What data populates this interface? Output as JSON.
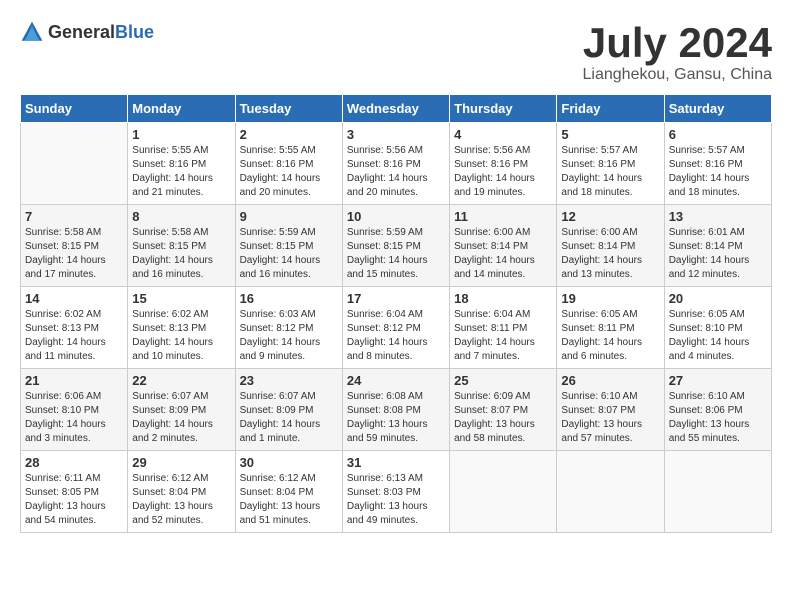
{
  "header": {
    "logo_general": "General",
    "logo_blue": "Blue",
    "month_year": "July 2024",
    "location": "Lianghekou, Gansu, China"
  },
  "days_of_week": [
    "Sunday",
    "Monday",
    "Tuesday",
    "Wednesday",
    "Thursday",
    "Friday",
    "Saturday"
  ],
  "weeks": [
    [
      {
        "day": "",
        "info": ""
      },
      {
        "day": "1",
        "info": "Sunrise: 5:55 AM\nSunset: 8:16 PM\nDaylight: 14 hours\nand 21 minutes."
      },
      {
        "day": "2",
        "info": "Sunrise: 5:55 AM\nSunset: 8:16 PM\nDaylight: 14 hours\nand 20 minutes."
      },
      {
        "day": "3",
        "info": "Sunrise: 5:56 AM\nSunset: 8:16 PM\nDaylight: 14 hours\nand 20 minutes."
      },
      {
        "day": "4",
        "info": "Sunrise: 5:56 AM\nSunset: 8:16 PM\nDaylight: 14 hours\nand 19 minutes."
      },
      {
        "day": "5",
        "info": "Sunrise: 5:57 AM\nSunset: 8:16 PM\nDaylight: 14 hours\nand 18 minutes."
      },
      {
        "day": "6",
        "info": "Sunrise: 5:57 AM\nSunset: 8:16 PM\nDaylight: 14 hours\nand 18 minutes."
      }
    ],
    [
      {
        "day": "7",
        "info": "Sunrise: 5:58 AM\nSunset: 8:15 PM\nDaylight: 14 hours\nand 17 minutes."
      },
      {
        "day": "8",
        "info": "Sunrise: 5:58 AM\nSunset: 8:15 PM\nDaylight: 14 hours\nand 16 minutes."
      },
      {
        "day": "9",
        "info": "Sunrise: 5:59 AM\nSunset: 8:15 PM\nDaylight: 14 hours\nand 16 minutes."
      },
      {
        "day": "10",
        "info": "Sunrise: 5:59 AM\nSunset: 8:15 PM\nDaylight: 14 hours\nand 15 minutes."
      },
      {
        "day": "11",
        "info": "Sunrise: 6:00 AM\nSunset: 8:14 PM\nDaylight: 14 hours\nand 14 minutes."
      },
      {
        "day": "12",
        "info": "Sunrise: 6:00 AM\nSunset: 8:14 PM\nDaylight: 14 hours\nand 13 minutes."
      },
      {
        "day": "13",
        "info": "Sunrise: 6:01 AM\nSunset: 8:14 PM\nDaylight: 14 hours\nand 12 minutes."
      }
    ],
    [
      {
        "day": "14",
        "info": "Sunrise: 6:02 AM\nSunset: 8:13 PM\nDaylight: 14 hours\nand 11 minutes."
      },
      {
        "day": "15",
        "info": "Sunrise: 6:02 AM\nSunset: 8:13 PM\nDaylight: 14 hours\nand 10 minutes."
      },
      {
        "day": "16",
        "info": "Sunrise: 6:03 AM\nSunset: 8:12 PM\nDaylight: 14 hours\nand 9 minutes."
      },
      {
        "day": "17",
        "info": "Sunrise: 6:04 AM\nSunset: 8:12 PM\nDaylight: 14 hours\nand 8 minutes."
      },
      {
        "day": "18",
        "info": "Sunrise: 6:04 AM\nSunset: 8:11 PM\nDaylight: 14 hours\nand 7 minutes."
      },
      {
        "day": "19",
        "info": "Sunrise: 6:05 AM\nSunset: 8:11 PM\nDaylight: 14 hours\nand 6 minutes."
      },
      {
        "day": "20",
        "info": "Sunrise: 6:05 AM\nSunset: 8:10 PM\nDaylight: 14 hours\nand 4 minutes."
      }
    ],
    [
      {
        "day": "21",
        "info": "Sunrise: 6:06 AM\nSunset: 8:10 PM\nDaylight: 14 hours\nand 3 minutes."
      },
      {
        "day": "22",
        "info": "Sunrise: 6:07 AM\nSunset: 8:09 PM\nDaylight: 14 hours\nand 2 minutes."
      },
      {
        "day": "23",
        "info": "Sunrise: 6:07 AM\nSunset: 8:09 PM\nDaylight: 14 hours\nand 1 minute."
      },
      {
        "day": "24",
        "info": "Sunrise: 6:08 AM\nSunset: 8:08 PM\nDaylight: 13 hours\nand 59 minutes."
      },
      {
        "day": "25",
        "info": "Sunrise: 6:09 AM\nSunset: 8:07 PM\nDaylight: 13 hours\nand 58 minutes."
      },
      {
        "day": "26",
        "info": "Sunrise: 6:10 AM\nSunset: 8:07 PM\nDaylight: 13 hours\nand 57 minutes."
      },
      {
        "day": "27",
        "info": "Sunrise: 6:10 AM\nSunset: 8:06 PM\nDaylight: 13 hours\nand 55 minutes."
      }
    ],
    [
      {
        "day": "28",
        "info": "Sunrise: 6:11 AM\nSunset: 8:05 PM\nDaylight: 13 hours\nand 54 minutes."
      },
      {
        "day": "29",
        "info": "Sunrise: 6:12 AM\nSunset: 8:04 PM\nDaylight: 13 hours\nand 52 minutes."
      },
      {
        "day": "30",
        "info": "Sunrise: 6:12 AM\nSunset: 8:04 PM\nDaylight: 13 hours\nand 51 minutes."
      },
      {
        "day": "31",
        "info": "Sunrise: 6:13 AM\nSunset: 8:03 PM\nDaylight: 13 hours\nand 49 minutes."
      },
      {
        "day": "",
        "info": ""
      },
      {
        "day": "",
        "info": ""
      },
      {
        "day": "",
        "info": ""
      }
    ]
  ]
}
